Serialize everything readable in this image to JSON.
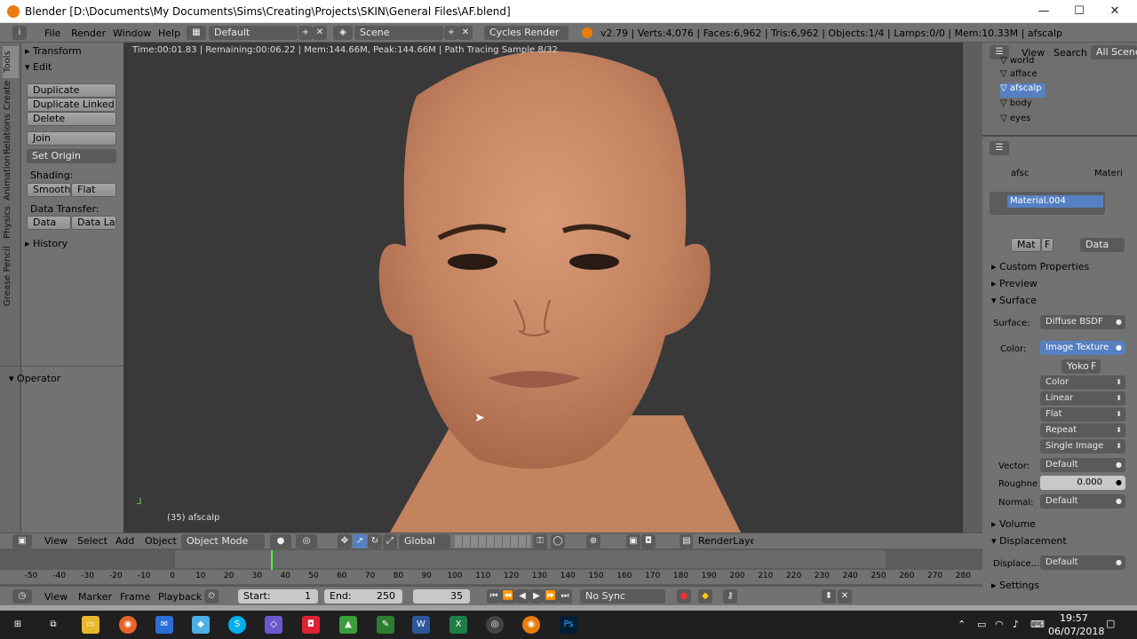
{
  "window": {
    "title": "Blender [D:\\Documents\\My Documents\\Sims\\Creating\\Projects\\SKIN\\General Files\\AF.blend]",
    "minimize": "—",
    "maximize": "☐",
    "close": "✕"
  },
  "menubar": {
    "items": [
      "File",
      "Render",
      "Window",
      "Help"
    ],
    "layout": "Default",
    "scene": "Scene",
    "engine": "Cycles Render",
    "stats": "v2.79 | Verts:4,076 | Faces:6,962 | Tris:6,962 | Objects:1/4 | Lamps:0/0 | Mem:10.33M | afscalp"
  },
  "toolstrip_tabs": [
    "Tools",
    "Create",
    "Relations",
    "Animation",
    "Physics",
    "Grease Pencil"
  ],
  "toolshelf": {
    "transform": "Transform",
    "edit": "Edit",
    "duplicate": "Duplicate",
    "duplicate_linked": "Duplicate Linked",
    "delete": "Delete",
    "join": "Join",
    "set_origin": "Set Origin",
    "shading_label": "Shading:",
    "smooth": "Smooth",
    "flat": "Flat",
    "data_transfer_label": "Data Transfer:",
    "data": "Data",
    "data_lay": "Data Lay",
    "history": "History",
    "operator": "Operator"
  },
  "viewport": {
    "render_info": "Time:00:01.83 | Remaining:00:06.22 | Mem:144.66M, Peak:144.66M | Path Tracing Sample 8/32",
    "object_label": "(35) afscalp"
  },
  "outliner": {
    "view": "View",
    "search": "Search",
    "scenes": "All Scenes",
    "rows": [
      "world",
      "afface",
      "afscalp",
      "body",
      "eyes"
    ]
  },
  "properties": {
    "breadcrumb_obj": "afsc",
    "breadcrumb_mat": "Materi",
    "material_slot": "Material.004",
    "mat_tab": "Mat",
    "f_tab": "F",
    "data_dd": "Data",
    "custom_props": "Custom Properties",
    "preview": "Preview",
    "surface_hdr": "Surface",
    "surface_label": "Surface:",
    "surface_val": "Diffuse BSDF",
    "color_label": "Color:",
    "color_val": "Image Texture",
    "image_name": "Yoko",
    "image_f": "F",
    "dd_color": "Color",
    "dd_linear": "Linear",
    "dd_flat": "Flat",
    "dd_repeat": "Repeat",
    "dd_single": "Single Image",
    "vector_label": "Vector:",
    "vector_val": "Default",
    "rough_label": "Roughne",
    "rough_val": "0.000",
    "normal_label": "Normal:",
    "normal_val": "Default",
    "volume": "Volume",
    "displacement": "Displacement",
    "disp_label": "Displace...",
    "disp_val": "Default",
    "settings": "Settings"
  },
  "viewheader": {
    "view": "View",
    "select": "Select",
    "add": "Add",
    "object": "Object",
    "mode": "Object Mode",
    "orientation": "Global",
    "render_layer": "RenderLayer"
  },
  "timeline": {
    "ticks": [
      "-50",
      "-40",
      "-30",
      "-20",
      "-10",
      "0",
      "10",
      "20",
      "30",
      "40",
      "50",
      "60",
      "70",
      "80",
      "90",
      "100",
      "110",
      "120",
      "130",
      "140",
      "150",
      "160",
      "170",
      "180",
      "190",
      "200",
      "210",
      "220",
      "230",
      "240",
      "250",
      "260",
      "270",
      "280"
    ],
    "current_frame_value": 35,
    "view": "View",
    "marker": "Marker",
    "frame": "Frame",
    "playback": "Playback",
    "start_label": "Start:",
    "start_val": "1",
    "end_label": "End:",
    "end_val": "250",
    "current": "35",
    "sync": "No Sync"
  },
  "taskbar": {
    "time": "19:57",
    "date": "06/07/2018",
    "apps": [
      "start-icon",
      "task-view-icon",
      "file-explorer-icon",
      "firefox-icon",
      "mail-icon",
      "app-icon",
      "skype-icon",
      "app2-icon",
      "camera-icon",
      "maps-icon",
      "app3-icon",
      "excel-icon",
      "word-icon",
      "app4-icon",
      "blender-icon",
      "photoshop-icon"
    ]
  },
  "colors": {
    "ui_gray": "#727272",
    "field_dark": "#5a5a5a",
    "selection_blue": "#5680c2",
    "viewport_bg": "#393939",
    "skin": "#c98b68"
  }
}
